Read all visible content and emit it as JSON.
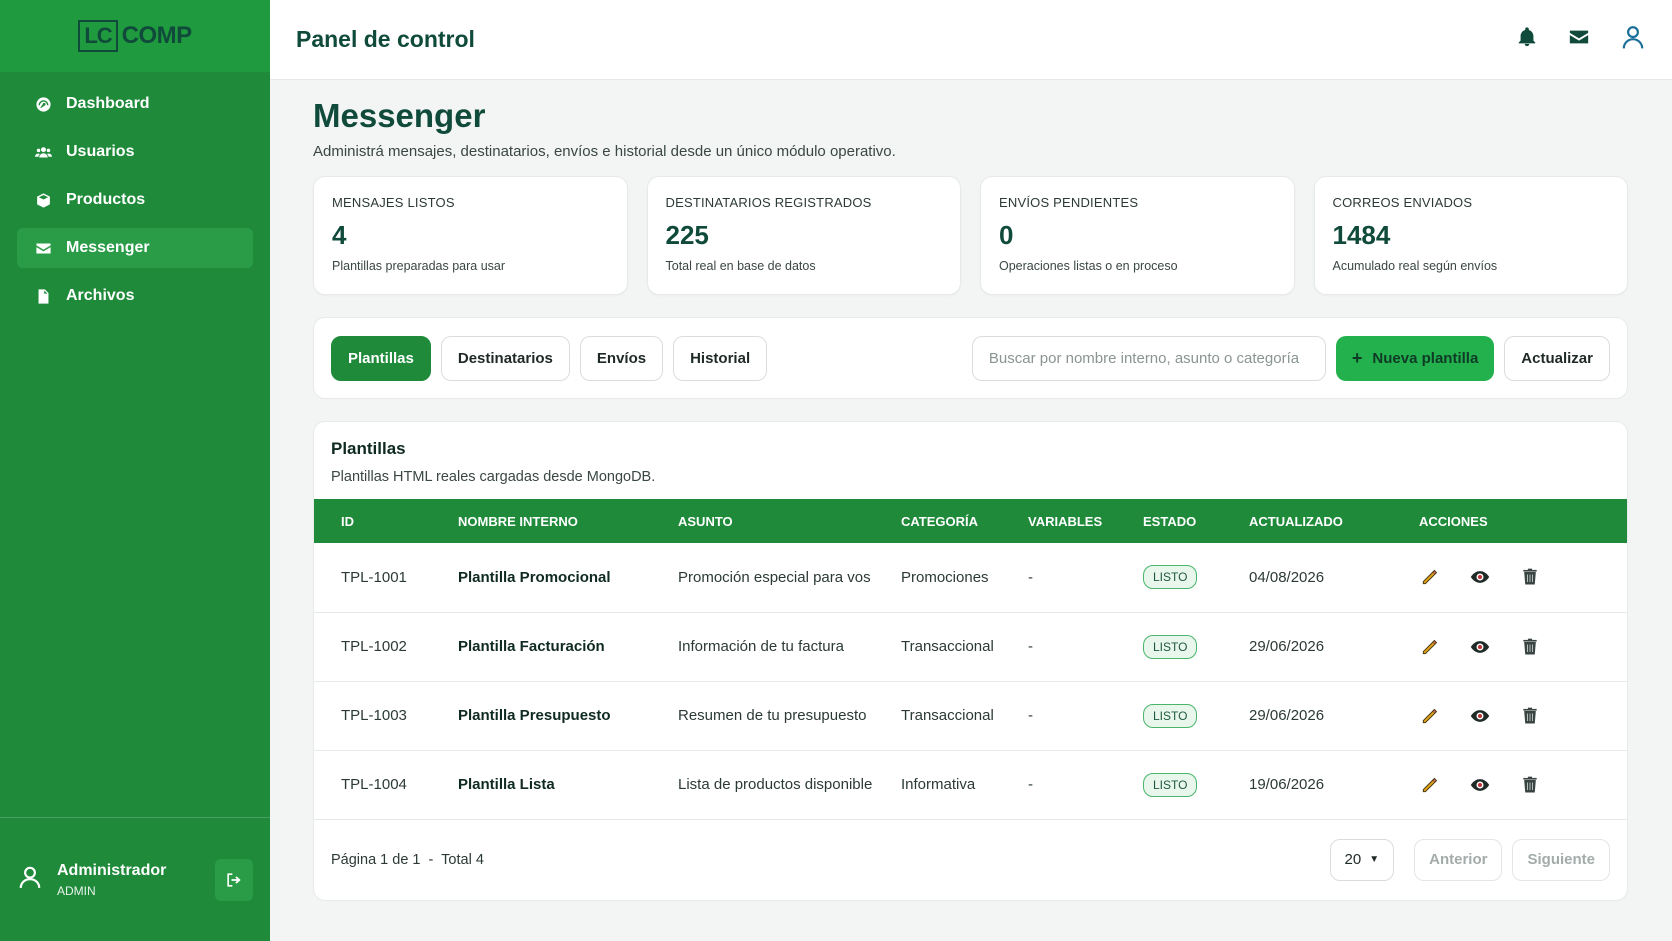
{
  "sidebar": {
    "logo_mark": "LC",
    "logo_text": "COMP",
    "items": [
      {
        "label": "Dashboard",
        "icon": "gauge-icon"
      },
      {
        "label": "Usuarios",
        "icon": "users-icon"
      },
      {
        "label": "Productos",
        "icon": "box-icon"
      },
      {
        "label": "Messenger",
        "icon": "envelope-icon",
        "active": true
      },
      {
        "label": "Archivos",
        "icon": "file-icon"
      }
    ],
    "user": {
      "name": "Administrador",
      "role": "ADMIN"
    }
  },
  "header": {
    "title": "Panel de control"
  },
  "page": {
    "title": "Messenger",
    "subtitle": "Administrá mensajes, destinatarios, envíos e historial desde un único módulo operativo."
  },
  "stats": [
    {
      "label": "MENSAJES LISTOS",
      "value": "4",
      "desc": "Plantillas preparadas para usar"
    },
    {
      "label": "DESTINATARIOS REGISTRADOS",
      "value": "225",
      "desc": "Total real en base de datos"
    },
    {
      "label": "ENVÍOS PENDIENTES",
      "value": "0",
      "desc": "Operaciones listas o en proceso"
    },
    {
      "label": "CORREOS ENVIADOS",
      "value": "1484",
      "desc": "Acumulado real según envíos"
    }
  ],
  "toolbar": {
    "tabs": [
      "Plantillas",
      "Destinatarios",
      "Envíos",
      "Historial"
    ],
    "search_placeholder": "Buscar por nombre interno, asunto o categoría",
    "new_label": "Nueva plantilla",
    "refresh_label": "Actualizar"
  },
  "panel": {
    "title": "Plantillas",
    "subtitle": "Plantillas HTML reales cargadas desde MongoDB.",
    "columns": [
      "ID",
      "NOMBRE INTERNO",
      "ASUNTO",
      "CATEGORÍA",
      "VARIABLES",
      "ESTADO",
      "ACTUALIZADO",
      "ACCIONES"
    ],
    "rows": [
      {
        "id": "TPL-1001",
        "name": "Plantilla Promocional",
        "subject": "Promoción especial para vos",
        "category": "Promociones",
        "variables": "-",
        "status": "LISTO",
        "updated": "04/08/2026"
      },
      {
        "id": "TPL-1002",
        "name": "Plantilla Facturación",
        "subject": "Información de tu factura",
        "category": "Transaccional",
        "variables": "-",
        "status": "LISTO",
        "updated": "29/06/2026"
      },
      {
        "id": "TPL-1003",
        "name": "Plantilla Presupuesto",
        "subject": "Resumen de tu presupuesto",
        "category": "Transaccional",
        "variables": "-",
        "status": "LISTO",
        "updated": "29/06/2026"
      },
      {
        "id": "TPL-1004",
        "name": "Plantilla Lista",
        "subject": "Lista de productos disponible",
        "category": "Informativa",
        "variables": "-",
        "status": "LISTO",
        "updated": "19/06/2026"
      }
    ],
    "pager": {
      "text": "Página 1 de 1  -  Total 4",
      "page_size": "20",
      "prev": "Anterior",
      "next": "Siguiente"
    }
  },
  "colors": {
    "sidebar": "#1e8a3a",
    "accent": "#22b14c",
    "title": "#0f4a3a"
  }
}
